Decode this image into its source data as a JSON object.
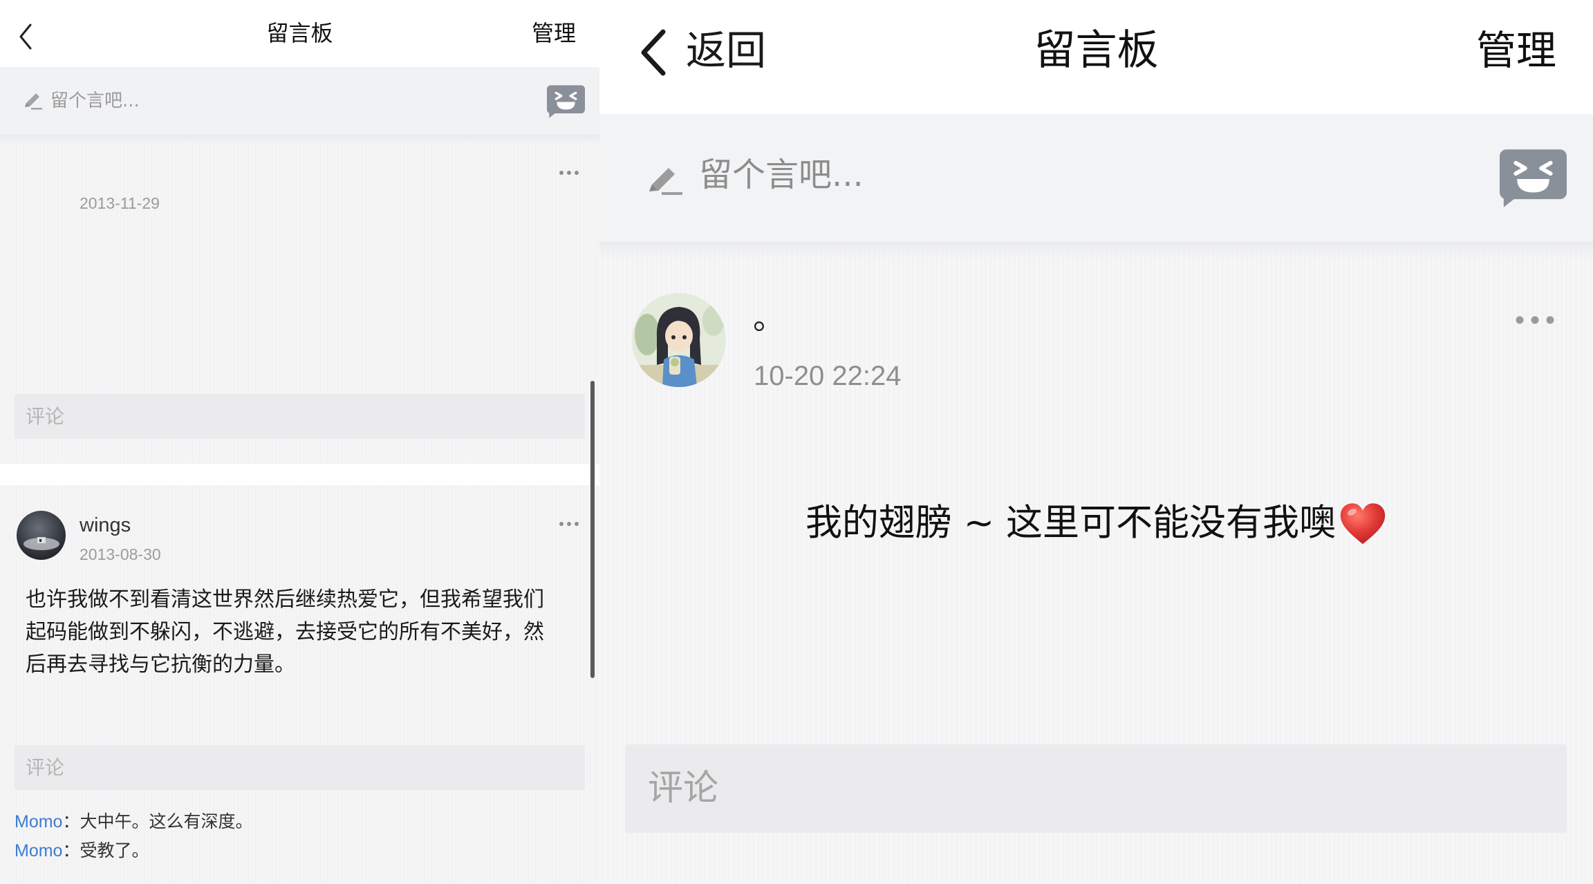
{
  "left": {
    "header": {
      "back_icon": "chevron-left-icon",
      "title": "留言板",
      "manage_label": "管理"
    },
    "composer": {
      "pencil_icon": "pencil-icon",
      "placeholder": "留个言吧...",
      "emoji_icon": "emoji-face-icon"
    },
    "posts": [
      {
        "date": "2013-11-29",
        "more_icon": "more-dots-icon",
        "comment_placeholder": "评论"
      },
      {
        "author": "wings",
        "date": "2013-08-30",
        "more_icon": "more-dots-icon",
        "body_lines": [
          "也许我做不到看清这世界然后继续热爱它，但我希望我们",
          "起码能做到不躲闪，不逃避，去接受它的所有不美好，然",
          "后再去寻找与它抗衡的力量。"
        ],
        "comment_placeholder": "评论",
        "replies": [
          {
            "author": "Momo",
            "separator": "：",
            "text": "大中午。这么有深度。"
          },
          {
            "author": "Momo",
            "separator": "：",
            "text": "受教了。"
          }
        ]
      }
    ]
  },
  "right": {
    "header": {
      "back_icon": "chevron-left-icon",
      "back_label": "返回",
      "title": "留言板",
      "manage_label": "管理"
    },
    "composer": {
      "pencil_icon": "pencil-icon",
      "placeholder": "留个言吧...",
      "emoji_icon": "emoji-face-icon"
    },
    "post": {
      "author": "。",
      "time": "10-20 22:24",
      "more_icon": "more-dots-icon",
      "message": "我的翅膀 ~ 这里可不能没有我噢",
      "message_emoji_icon": "red-heart-icon",
      "comment_placeholder": "评论"
    }
  },
  "colors": {
    "header_bg": "#ffffff",
    "composer_bg": "#f2f3f5",
    "page_bg": "#f5f5f6",
    "comment_bar_bg": "#ebebed",
    "reply_author": "#3d7bd0",
    "emoji_button": "#8a9099",
    "heart": "#e33a36"
  }
}
